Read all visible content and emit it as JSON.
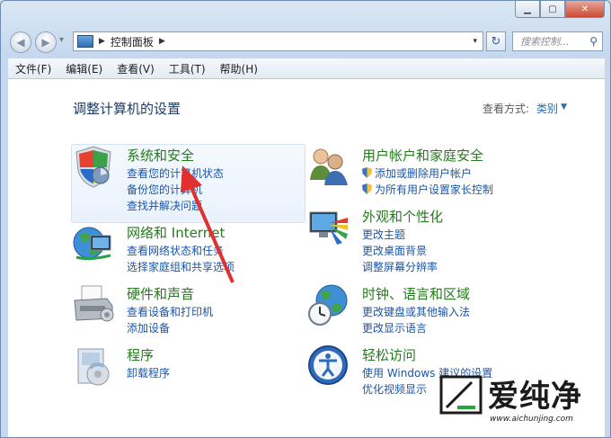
{
  "window": {
    "min_label": "▁",
    "max_label": "▢",
    "close_label": "✕"
  },
  "nav": {
    "back_icon": "◀",
    "forward_icon": "▶",
    "dropdown_icon": "▾"
  },
  "address": {
    "arrow": "▶",
    "path": "控制面板",
    "trail_arrow": "▶",
    "dropdown": "▾"
  },
  "refresh_icon": "↻",
  "search": {
    "placeholder": "搜索控制...",
    "icon": "⚲"
  },
  "menu": [
    "文件(F)",
    "编辑(E)",
    "查看(V)",
    "工具(T)",
    "帮助(H)"
  ],
  "page_title": "调整计算机的设置",
  "view_by": {
    "label": "查看方式:",
    "value": "类别",
    "dropdown": "▼"
  },
  "categories": [
    {
      "name": "系统和安全",
      "links": [
        "查看您的计算机状态",
        "备份您的计算机",
        "查找并解决问题"
      ]
    },
    {
      "name": "网络和 Internet",
      "links": [
        "查看网络状态和任务",
        "选择家庭组和共享选项"
      ]
    },
    {
      "name": "硬件和声音",
      "links": [
        "查看设备和打印机",
        "添加设备"
      ]
    },
    {
      "name": "程序",
      "links": [
        "卸载程序"
      ]
    },
    {
      "name": "用户帐户和家庭安全",
      "links": [
        "添加或删除用户帐户",
        "为所有用户设置家长控制"
      ]
    },
    {
      "name": "外观和个性化",
      "links": [
        "更改主题",
        "更改桌面背景",
        "调整屏幕分辨率"
      ]
    },
    {
      "name": "时钟、语言和区域",
      "links": [
        "更改键盘或其他输入法",
        "更改显示语言"
      ]
    },
    {
      "name": "轻松访问",
      "links": [
        "使用 Windows 建议的设置",
        "优化视频显示"
      ]
    }
  ],
  "watermark": {
    "text": "爱纯净",
    "url": "www.aichunjing.com"
  },
  "colors": {
    "category": "#257a1e",
    "link": "#1a56a8",
    "arrow": "#e0302f"
  }
}
